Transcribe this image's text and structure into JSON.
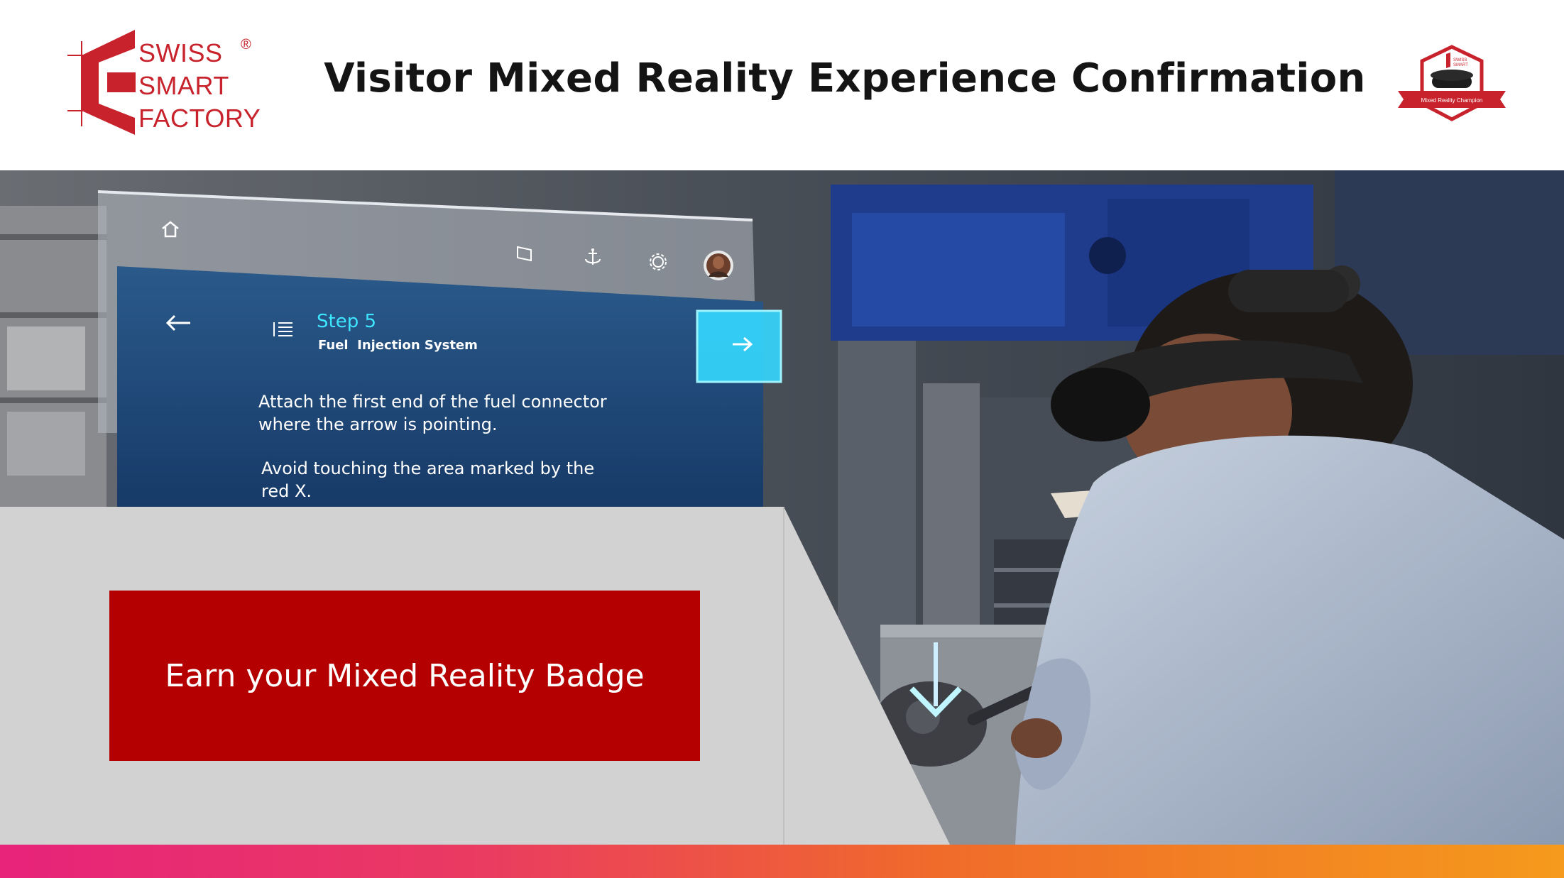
{
  "header": {
    "logo_lines": [
      "SWISS",
      "SMART",
      "FACTORY"
    ],
    "logo_mark": "®",
    "title": "Visitor Mixed Reality Experience Confirmation",
    "badge_caption": "Mixed Reality Champion"
  },
  "hud": {
    "step": "Step 5",
    "subtitle": "Fuel  Injection System",
    "instruction_1_line_1": "Attach the first end of the fuel connector",
    "instruction_1_line_2": "where the arrow is pointing.",
    "instruction_2_line_1": "Avoid touching the area marked by the",
    "instruction_2_line_2": "red X.",
    "icons": [
      "home-icon",
      "window-icon",
      "anchor-icon",
      "gear-icon",
      "avatar",
      "back-arrow-icon",
      "list-icon",
      "next-arrow-icon"
    ]
  },
  "cta": {
    "label": "Earn your Mixed Reality Badge"
  },
  "colors": {
    "brand_red": "#c8232c",
    "button_red": "#b40000",
    "hud_accent": "#3ee6ff",
    "panel_gray": "#d2d2d2"
  }
}
